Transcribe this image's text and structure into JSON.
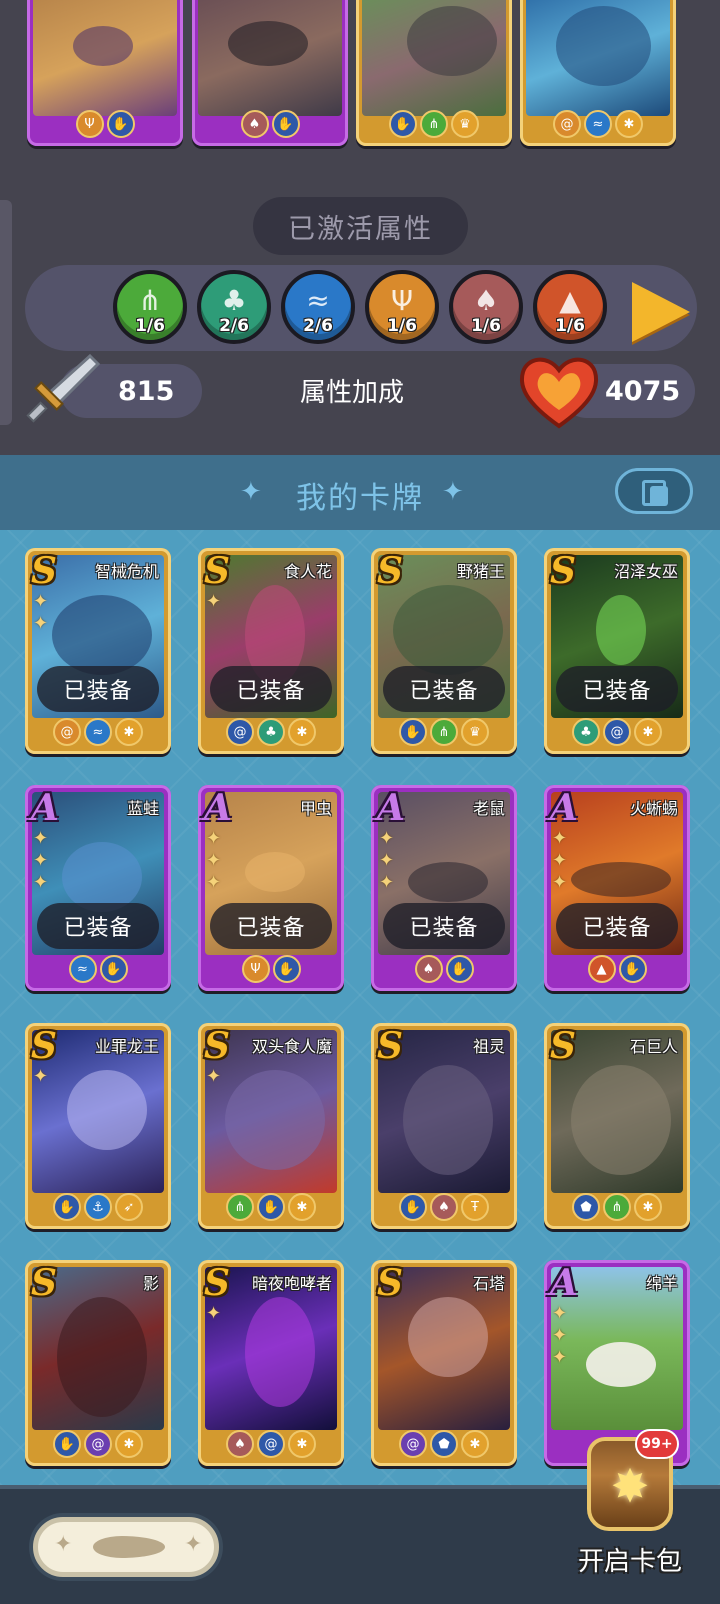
{
  "activated_panel": {
    "title": "已激活属性",
    "attributes": [
      {
        "icon": "grass-icon",
        "count": "1/6",
        "color": "#4caa3a",
        "glyph": "⋔"
      },
      {
        "icon": "sprout-icon",
        "count": "2/6",
        "color": "#2e9c78",
        "glyph": "♣"
      },
      {
        "icon": "wave-icon",
        "count": "2/6",
        "color": "#2a78c8",
        "glyph": "≈"
      },
      {
        "icon": "cactus-icon",
        "count": "1/6",
        "color": "#d98a2c",
        "glyph": "Ψ"
      },
      {
        "icon": "squid-icon",
        "count": "1/6",
        "color": "#a65a5a",
        "glyph": "♠"
      },
      {
        "icon": "volcano-icon",
        "count": "1/6",
        "color": "#d0542a",
        "glyph": "▲"
      }
    ],
    "attack_value": "815",
    "bonus_label": "属性加成",
    "health_value": "4075"
  },
  "my_cards": {
    "title": "我的卡牌",
    "equipped_label": "已装备",
    "cards": [
      {
        "name": "智械危机",
        "rank": "S",
        "stars": 2,
        "equipped": true,
        "attrs": [
          "c-orange",
          "c-blue",
          "c-gold"
        ]
      },
      {
        "name": "食人花",
        "rank": "S",
        "stars": 1,
        "equipped": true,
        "attrs": [
          "c-navy",
          "c-teal",
          "c-gold"
        ]
      },
      {
        "name": "野猪王",
        "rank": "S",
        "stars": 0,
        "equipped": true,
        "attrs": [
          "c-navy",
          "c-green",
          "c-gold"
        ]
      },
      {
        "name": "沼泽女巫",
        "rank": "S",
        "stars": 0,
        "equipped": true,
        "attrs": [
          "c-teal",
          "c-navy",
          "c-gold"
        ]
      },
      {
        "name": "蓝蛙",
        "rank": "A",
        "stars": 3,
        "equipped": true,
        "attrs": [
          "c-blue",
          "c-navy"
        ]
      },
      {
        "name": "甲虫",
        "rank": "A",
        "stars": 3,
        "equipped": true,
        "attrs": [
          "c-orange",
          "c-navy"
        ]
      },
      {
        "name": "老鼠",
        "rank": "A",
        "stars": 3,
        "equipped": true,
        "attrs": [
          "c-pink",
          "c-navy"
        ]
      },
      {
        "name": "火蜥蜴",
        "rank": "A",
        "stars": 3,
        "equipped": true,
        "attrs": [
          "c-red",
          "c-navy"
        ]
      },
      {
        "name": "业罪龙王",
        "rank": "S",
        "stars": 1,
        "equipped": false,
        "attrs": [
          "c-navy",
          "c-blue",
          "c-gold"
        ]
      },
      {
        "name": "双头食人魔",
        "rank": "S",
        "stars": 1,
        "equipped": false,
        "attrs": [
          "c-green",
          "c-navy",
          "c-gold"
        ]
      },
      {
        "name": "祖灵",
        "rank": "S",
        "stars": 0,
        "equipped": false,
        "attrs": [
          "c-navy",
          "c-pink",
          "c-gold"
        ]
      },
      {
        "name": "石巨人",
        "rank": "S",
        "stars": 0,
        "equipped": false,
        "attrs": [
          "c-navy",
          "c-green",
          "c-gold"
        ]
      },
      {
        "name": "影",
        "rank": "S",
        "stars": 0,
        "equipped": false,
        "attrs": [
          "c-navy",
          "c-purple",
          "c-gold"
        ]
      },
      {
        "name": "暗夜咆哮者",
        "rank": "S",
        "stars": 1,
        "equipped": false,
        "attrs": [
          "c-pink",
          "c-navy",
          "c-gold"
        ]
      },
      {
        "name": "石塔",
        "rank": "S",
        "stars": 0,
        "equipped": false,
        "attrs": [
          "c-purple",
          "c-navy",
          "c-gold"
        ]
      },
      {
        "name": "绵羊",
        "rank": "A",
        "stars": 3,
        "equipped": false,
        "attrs": []
      }
    ]
  },
  "bottom_bar": {
    "open_pack_label": "开启卡包",
    "pack_badge": "99+"
  },
  "colors": {
    "top_bg": "#45444f",
    "grid_bg": "#4f9ec0",
    "header_bg": "#3f6f8c",
    "rank_s": "#f6b929",
    "rank_a": "#c77ae8"
  }
}
